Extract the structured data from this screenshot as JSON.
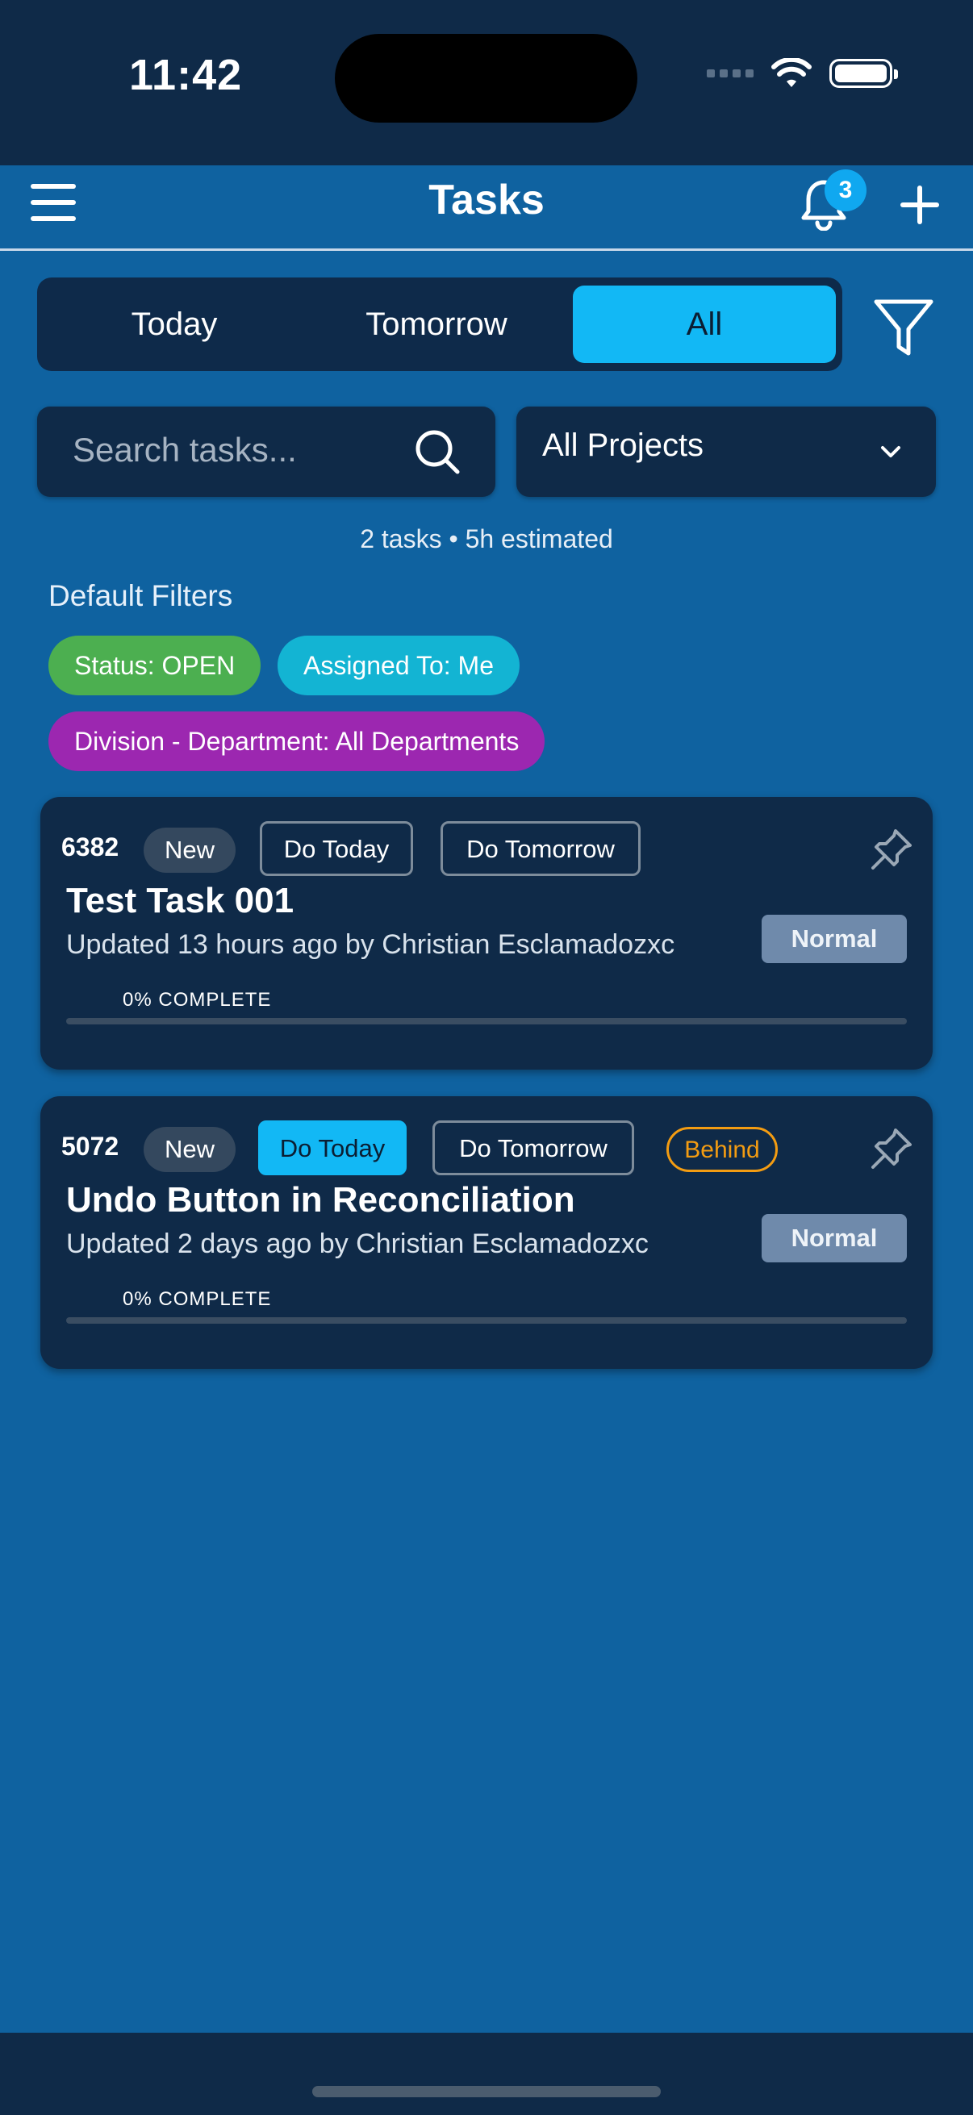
{
  "status_bar": {
    "time": "11:42"
  },
  "header": {
    "title": "Tasks",
    "notification_count": "3"
  },
  "segments": {
    "today": "Today",
    "tomorrow": "Tomorrow",
    "all": "All",
    "selected": "All"
  },
  "search": {
    "placeholder": "Search tasks..."
  },
  "project_select": {
    "value": "All Projects"
  },
  "summary": "2 tasks • 5h estimated",
  "default_filters": {
    "label": "Default Filters",
    "chips": [
      "Status: OPEN",
      "Assigned To: Me",
      "Division - Department: All Departments"
    ]
  },
  "tasks": [
    {
      "id": "6382",
      "status": "New",
      "do_today": "Do Today",
      "do_tomorrow": "Do Tomorrow",
      "do_today_active": false,
      "title": "Test Task 001",
      "updated": "Updated 13 hours ago by Christian Esclamadozxc",
      "priority": "Normal",
      "progress_label": "0% COMPLETE",
      "progress": 0
    },
    {
      "id": "5072",
      "status": "New",
      "do_today": "Do Today",
      "do_tomorrow": "Do Tomorrow",
      "do_today_active": true,
      "flag": "Behind",
      "title": "Undo Button in Reconciliation",
      "updated": "Updated 2 days ago by Christian Esclamadozxc",
      "priority": "Normal",
      "progress_label": "0% COMPLETE",
      "progress": 0
    }
  ],
  "colors": {
    "accent": "#12b8f5",
    "background": "#0f62a0",
    "card": "#0f2a48",
    "behind": "#f39c12"
  }
}
